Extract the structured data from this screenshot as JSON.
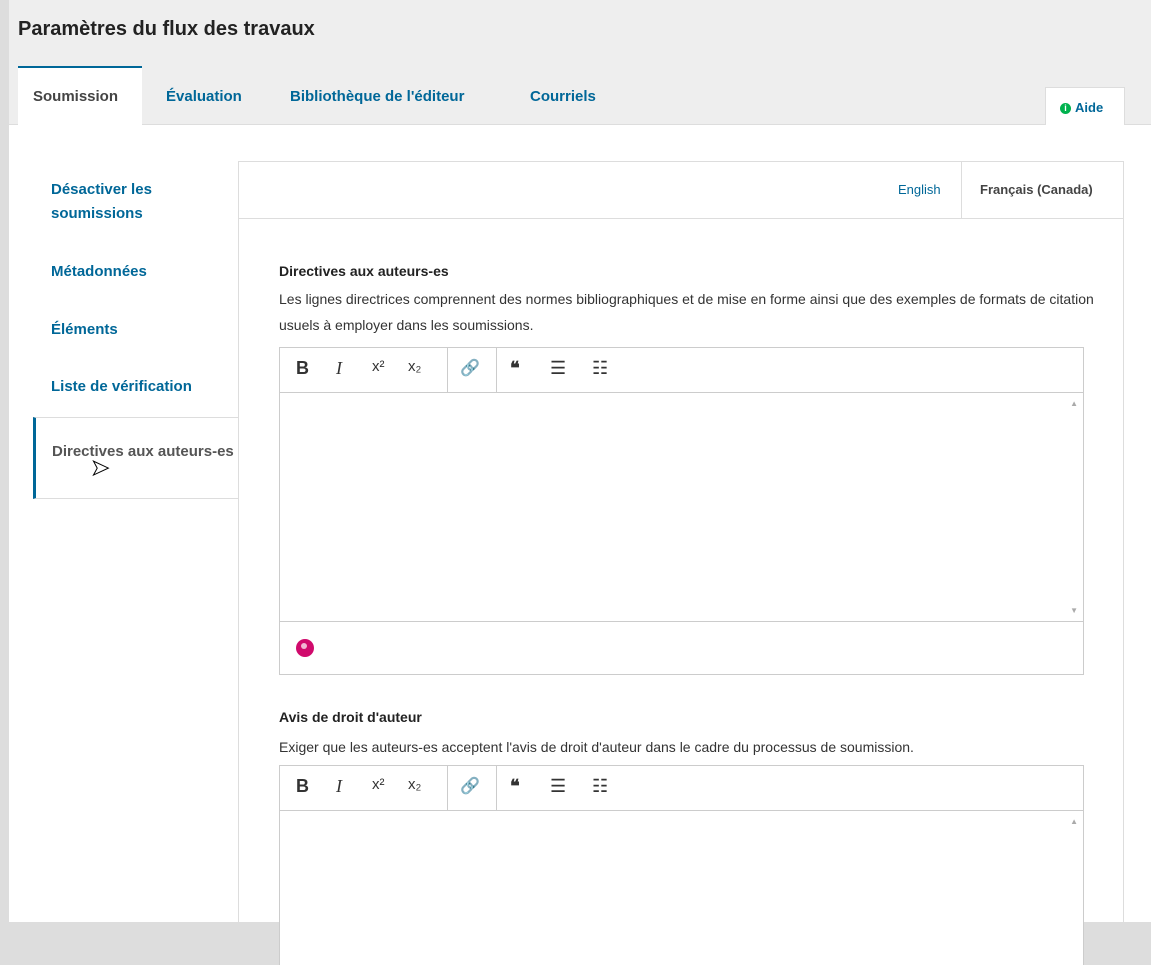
{
  "header": {
    "title": "Paramètres du flux des travaux",
    "tabs": [
      {
        "label": "Soumission"
      },
      {
        "label": "Évaluation"
      },
      {
        "label": "Bibliothèque de l'éditeur"
      },
      {
        "label": "Courriels"
      }
    ],
    "help_label": "Aide"
  },
  "sidebar": {
    "items": [
      {
        "label": "Désactiver les soumissions"
      },
      {
        "label": "Métadonnées"
      },
      {
        "label": "Éléments"
      },
      {
        "label": "Liste de vérification"
      },
      {
        "label": "Directives aux auteurs-es"
      }
    ]
  },
  "locales": {
    "english": "English",
    "french": "Français (Canada)"
  },
  "fields": [
    {
      "label": "Directives aux auteurs-es",
      "description": "Les lignes directrices comprennent des normes bibliographiques et de mise en forme ainsi que des exemples de formats de citation usuels à employer dans les soumissions."
    },
    {
      "label": "Avis de droit d'auteur",
      "description": "Exiger que les auteurs-es acceptent l'avis de droit d'auteur dans le cadre du processus de soumission."
    }
  ],
  "toolbar": {
    "bold": "B",
    "italic": "I",
    "superscript": "x²",
    "subscript": "x₂",
    "link": "🔗",
    "quote": "❝",
    "bullet_list": "☰",
    "numbered_list": "☷"
  },
  "colors": {
    "accent": "#006798",
    "globe": "#d00a6c",
    "info": "#00b24e"
  }
}
